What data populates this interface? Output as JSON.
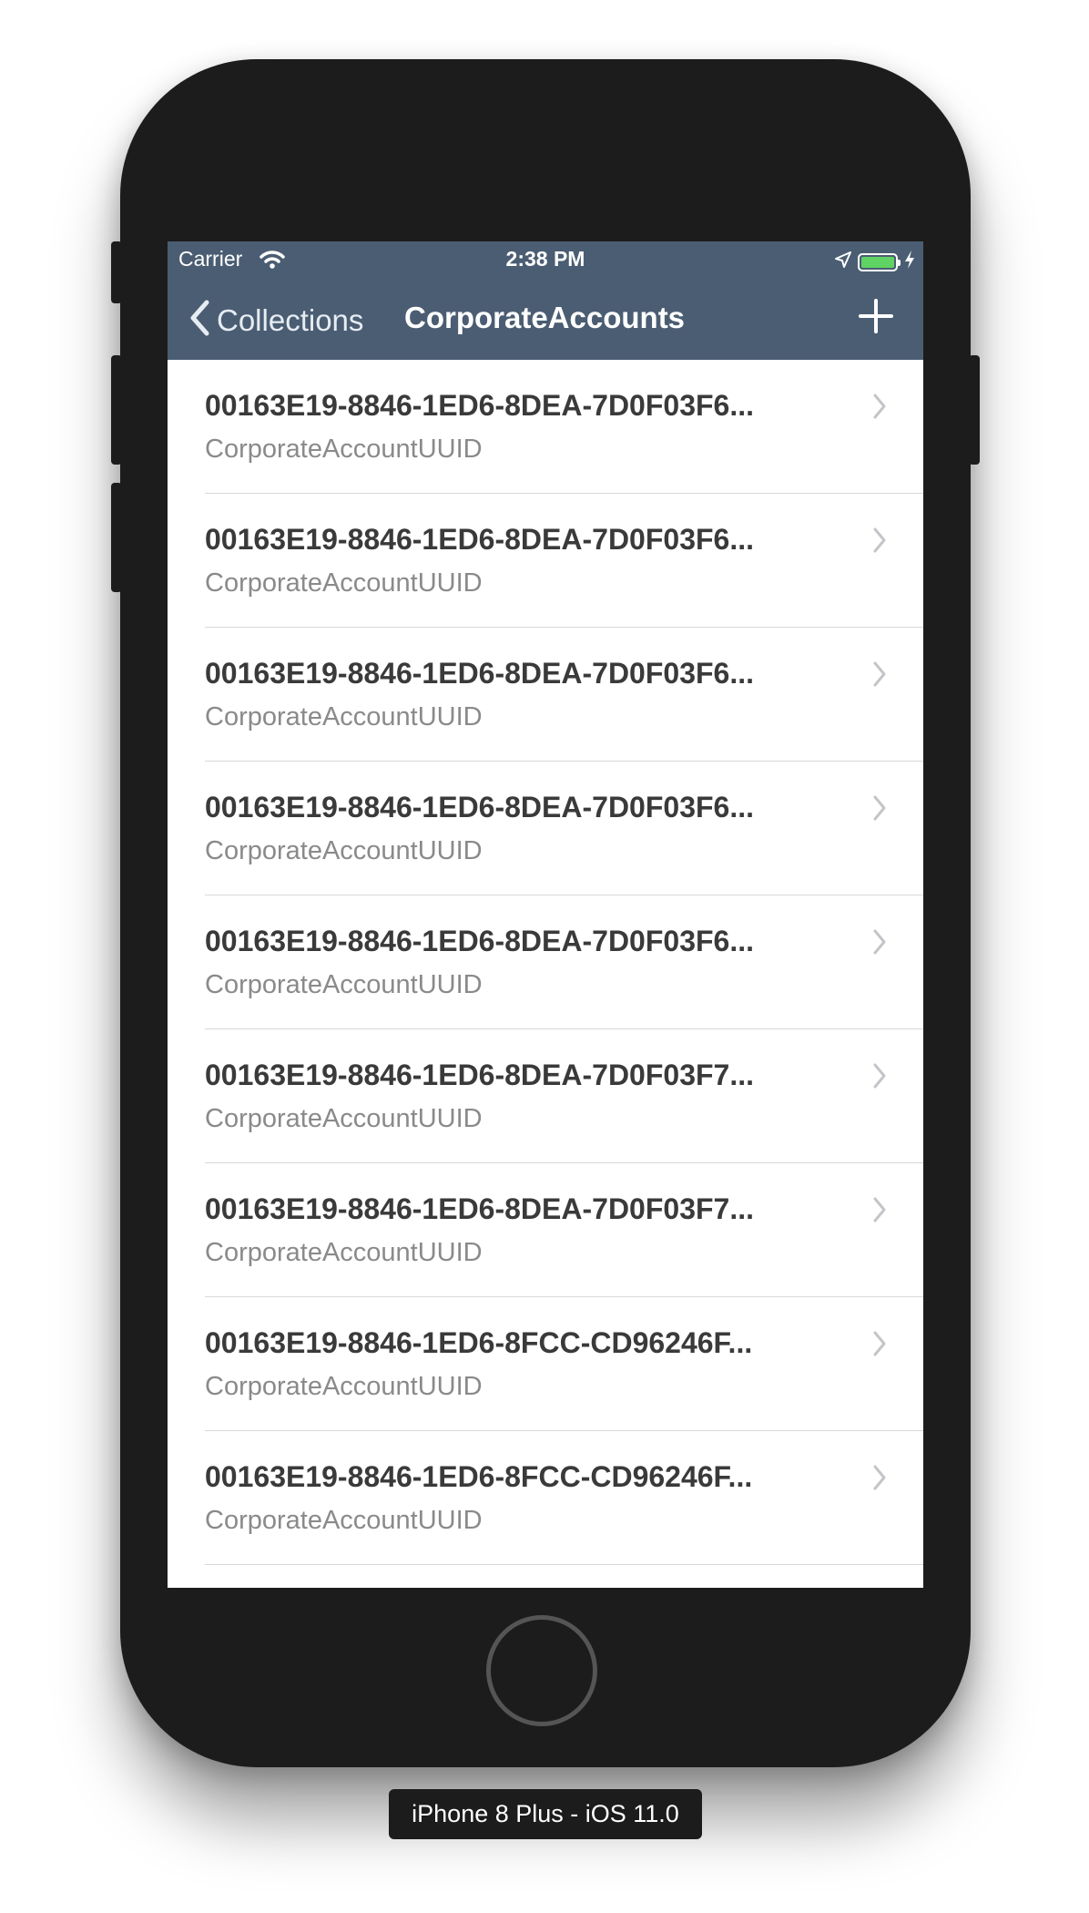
{
  "status_bar": {
    "carrier": "Carrier",
    "time": "2:38 PM",
    "battery_level": 1.0,
    "icons": [
      "wifi-icon",
      "location-arrow-icon",
      "battery-icon",
      "charging-bolt-icon"
    ]
  },
  "nav_bar": {
    "back_label": "Collections",
    "title": "CorporateAccounts",
    "add_icon": "plus-icon"
  },
  "list": {
    "items": [
      {
        "title": "00163E19-8846-1ED6-8DEA-7D0F03F6...",
        "subtitle": "CorporateAccountUUID"
      },
      {
        "title": "00163E19-8846-1ED6-8DEA-7D0F03F6...",
        "subtitle": "CorporateAccountUUID"
      },
      {
        "title": "00163E19-8846-1ED6-8DEA-7D0F03F6...",
        "subtitle": "CorporateAccountUUID"
      },
      {
        "title": "00163E19-8846-1ED6-8DEA-7D0F03F6...",
        "subtitle": "CorporateAccountUUID"
      },
      {
        "title": "00163E19-8846-1ED6-8DEA-7D0F03F6...",
        "subtitle": "CorporateAccountUUID"
      },
      {
        "title": "00163E19-8846-1ED6-8DEA-7D0F03F7...",
        "subtitle": "CorporateAccountUUID"
      },
      {
        "title": "00163E19-8846-1ED6-8DEA-7D0F03F7...",
        "subtitle": "CorporateAccountUUID"
      },
      {
        "title": "00163E19-8846-1ED6-8FCC-CD96246F...",
        "subtitle": "CorporateAccountUUID"
      },
      {
        "title": "00163E19-8846-1ED6-8FCC-CD96246F...",
        "subtitle": "CorporateAccountUUID"
      }
    ]
  },
  "device_label": "iPhone 8 Plus - iOS 11.0",
  "colors": {
    "nav_background": "#4a5d72",
    "device_body": "#1c1c1c",
    "battery_fill": "#5fd364"
  }
}
